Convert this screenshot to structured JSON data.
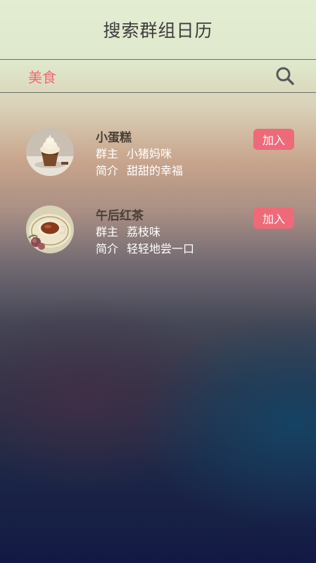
{
  "header": {
    "title": "搜索群组日历"
  },
  "search": {
    "value": "美食",
    "icon": "search-icon"
  },
  "colors": {
    "accent": "#ef6a79",
    "search_text": "#ef6a75"
  },
  "groups": [
    {
      "name": "小蛋糕",
      "owner_label": "群主",
      "owner": "小猪妈咪",
      "intro_label": "简介",
      "intro": "甜甜的幸福",
      "join_label": "加入",
      "avatar_icon": "cupcake-icon"
    },
    {
      "name": "午后红茶",
      "owner_label": "群主",
      "owner": "荔枝味",
      "intro_label": "简介",
      "intro": "轻轻地尝一口",
      "join_label": "加入",
      "avatar_icon": "tea-cup-icon"
    }
  ]
}
